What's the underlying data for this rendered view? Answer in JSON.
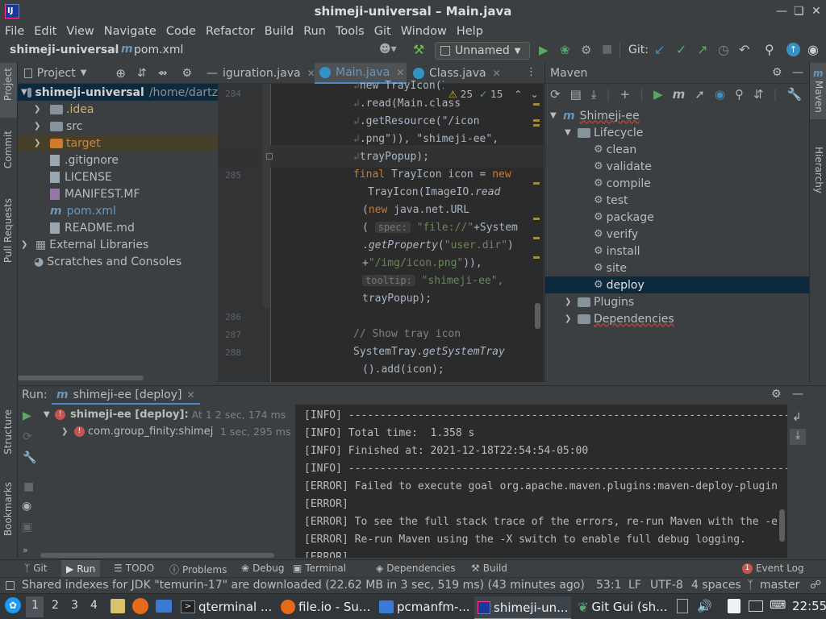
{
  "window": {
    "title": "shimeji-universal – Main.java",
    "app_icon": "IJ"
  },
  "menu": [
    "File",
    "Edit",
    "View",
    "Navigate",
    "Code",
    "Refactor",
    "Build",
    "Run",
    "Tools",
    "Git",
    "Window",
    "Help"
  ],
  "nav": {
    "project": "shimeji-universal",
    "file": "pom.xml",
    "run_config": "Unnamed",
    "git_label": "Git:"
  },
  "left_strip": [
    "Project",
    "Commit",
    "Pull Requests",
    "Structure",
    "Bookmarks"
  ],
  "project_panel": {
    "title": "Project",
    "tree": [
      {
        "label": "shimeji-universal",
        "suffix": "/home/dartz",
        "kind": "root"
      },
      {
        "label": ".idea",
        "kind": "folder-idea"
      },
      {
        "label": "src",
        "kind": "folder"
      },
      {
        "label": "target",
        "kind": "folder-target"
      },
      {
        "label": ".gitignore",
        "kind": "file"
      },
      {
        "label": "LICENSE",
        "kind": "file"
      },
      {
        "label": "MANIFEST.MF",
        "kind": "file"
      },
      {
        "label": "pom.xml",
        "kind": "maven"
      },
      {
        "label": "README.md",
        "kind": "file"
      },
      {
        "label": "External Libraries",
        "kind": "lib"
      },
      {
        "label": "Scratches and Consoles",
        "kind": "scratch"
      }
    ]
  },
  "editor": {
    "tabs": [
      "iguration.java",
      "Main.java",
      "Class.java"
    ],
    "warnings": "25",
    "checks": "15",
    "line_numbers": [
      "284",
      "285",
      "286",
      "287",
      "288"
    ],
    "code": {
      "l1": "new TrayIcon(ImageIO.",
      "l2": ".read(Main.class",
      "l3": ".getResource(\"/icon",
      "l4": ".png\")), \"shimeji-ee\", ",
      "l5": "trayPopup);",
      "l6a": "final",
      "l6b": " TrayIcon icon = ",
      "l6c": "new",
      "l7": "TrayIcon(ImageIO.",
      "l7b": "read",
      "l8a": "(",
      "l8b": "new",
      "l8c": " java.net.URL",
      "l9a": "( ",
      "hint_spec": "spec:",
      "l9b": " \"file://\"",
      "l9c": "+System",
      "l10a": ".",
      "l10b": "getProperty",
      "l10c": "(",
      "l10d": "\"user.dir\"",
      "l10e": ")",
      "l11a": "+",
      "l11b": "\"/img/icon.png\"",
      "l11c": ")),",
      "hint_tooltip": "tooltip:",
      "l12": " \"shimeji-ee\",",
      "l13": "trayPopup);",
      "l14": "// Show tray icon",
      "l15a": "SystemTray.",
      "l15b": "getSystemTray",
      "l16": "().add(icon);"
    }
  },
  "maven": {
    "title": "Maven",
    "root": "Shimeji-ee",
    "lifecycle": "Lifecycle",
    "goals": [
      "clean",
      "validate",
      "compile",
      "test",
      "package",
      "verify",
      "install",
      "site",
      "deploy"
    ],
    "selected": "deploy",
    "plugins": "Plugins",
    "dependencies": "Dependencies"
  },
  "right_strip": [
    "Maven",
    "Hierarchy"
  ],
  "run": {
    "label": "Run:",
    "tab": "shimeji-ee [deploy]",
    "tree": [
      {
        "label": "shimeji-ee [deploy]:",
        "time": "At 1 2 sec, 174 ms"
      },
      {
        "label": "com.group_finity:shimej",
        "time": "1 sec, 295 ms"
      }
    ],
    "console": [
      "[INFO] ------------------------------------------------------------------------",
      "[INFO] Total time:  1.358 s",
      "[INFO] Finished at: 2021-12-18T22:54:54-05:00",
      "[INFO] ------------------------------------------------------------------------",
      "[ERROR] Failed to execute goal org.apache.maven.plugins:maven-deploy-plugin",
      "[ERROR]",
      "[ERROR] To see the full stack trace of the errors, re-run Maven with the -e",
      "[ERROR] Re-run Maven using the -X switch to enable full debug logging.",
      "[ERROR]"
    ]
  },
  "tool_tabs": [
    "Git",
    "Run",
    "TODO",
    "Problems",
    "Debug",
    "Terminal",
    "Dependencies",
    "Build"
  ],
  "event_log": {
    "count": "1",
    "label": "Event Log"
  },
  "status": {
    "message": "Shared indexes for JDK \"temurin-17\" are downloaded (22.62 MB in 3 sec, 519 ms) (43 minutes ago)",
    "position": "53:1",
    "line_sep": "LF",
    "encoding": "UTF-8",
    "indent": "4 spaces",
    "branch": "master"
  },
  "taskbar": {
    "desktops": [
      "1",
      "2",
      "3",
      "4"
    ],
    "apps": [
      "qterminal ...",
      "file.io - Su...",
      "pcmanfm-...",
      "shimeji-un...",
      "Git Gui (sh..."
    ],
    "clock": "22:55"
  }
}
